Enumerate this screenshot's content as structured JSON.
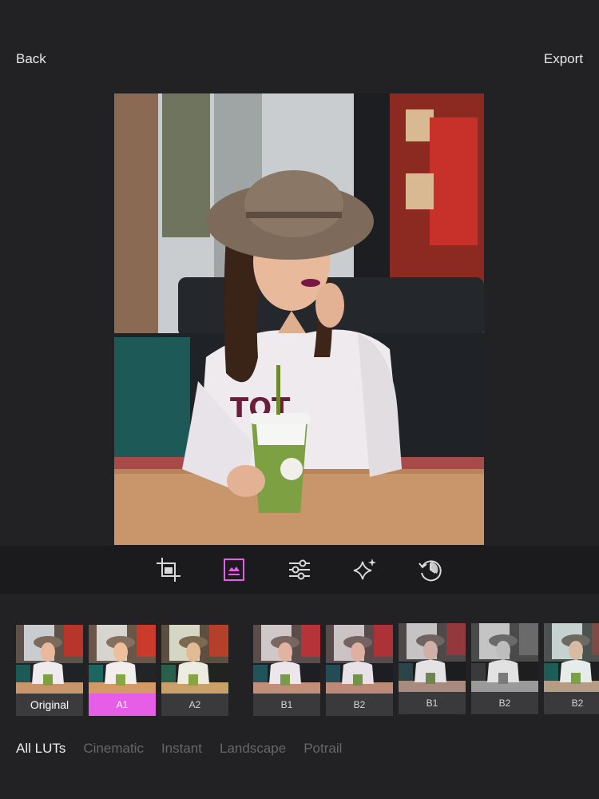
{
  "header": {
    "back_label": "Back",
    "export_label": "Export"
  },
  "tools": [
    {
      "name": "crop-icon"
    },
    {
      "name": "filter-image-icon",
      "active": true
    },
    {
      "name": "adjust-sliders-icon"
    },
    {
      "name": "sparkle-effects-icon"
    },
    {
      "name": "history-icon"
    }
  ],
  "filters": [
    {
      "label": "Original"
    },
    {
      "label": "A1",
      "selected": true
    },
    {
      "label": "A2"
    },
    {
      "label": "B1"
    },
    {
      "label": "B2"
    },
    {
      "label": "B1"
    },
    {
      "label": "B2"
    },
    {
      "label": "B2"
    }
  ],
  "categories": [
    {
      "label": "All LUTs",
      "active": true
    },
    {
      "label": "Cinematic"
    },
    {
      "label": "Instant"
    },
    {
      "label": "Landscape"
    },
    {
      "label": "Potrail"
    }
  ],
  "colors": {
    "accent": "#e65de8",
    "background": "#222224",
    "toolbar": "#1b1b1d"
  }
}
